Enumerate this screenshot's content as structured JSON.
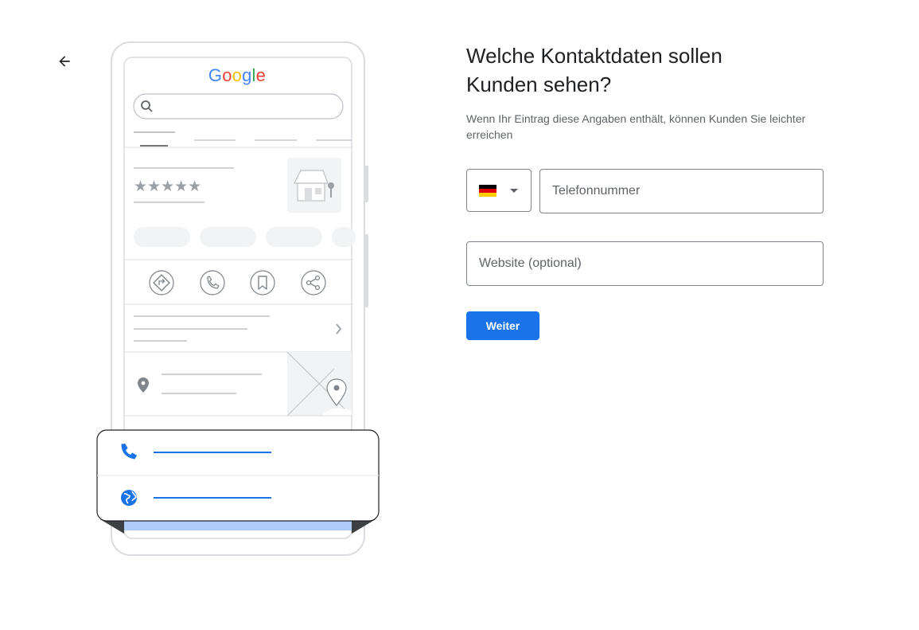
{
  "back": {
    "icon": "arrow-back-icon"
  },
  "illustration": {
    "logo_text": [
      "G",
      "o",
      "o",
      "g",
      "l",
      "e"
    ],
    "logo_colors": [
      "#4285F4",
      "#EA4335",
      "#FBBC05",
      "#4285F4",
      "#34A853",
      "#EA4335"
    ],
    "rating_stars": "★★★★★",
    "action_icons": [
      "directions-icon",
      "phone-icon",
      "bookmark-icon",
      "share-icon"
    ],
    "popup_icons": [
      "phone-icon",
      "globe-icon"
    ],
    "accent_color": "#1a73e8"
  },
  "form": {
    "title_line1": "Welche Kontaktdaten sollen",
    "title_line2": "Kunden sehen?",
    "subtitle": "Wenn Ihr Eintrag diese Angaben enthält, können Kunden Sie leichter erreichen",
    "country": {
      "flag": "de-flag-icon",
      "flag_colors": [
        "#000000",
        "#DD0000",
        "#FFCE00"
      ]
    },
    "phone_placeholder": "Telefonnummer",
    "phone_value": "",
    "website_placeholder": "Website (optional)",
    "website_value": "",
    "next_label": "Weiter",
    "button_color": "#1a73e8"
  }
}
